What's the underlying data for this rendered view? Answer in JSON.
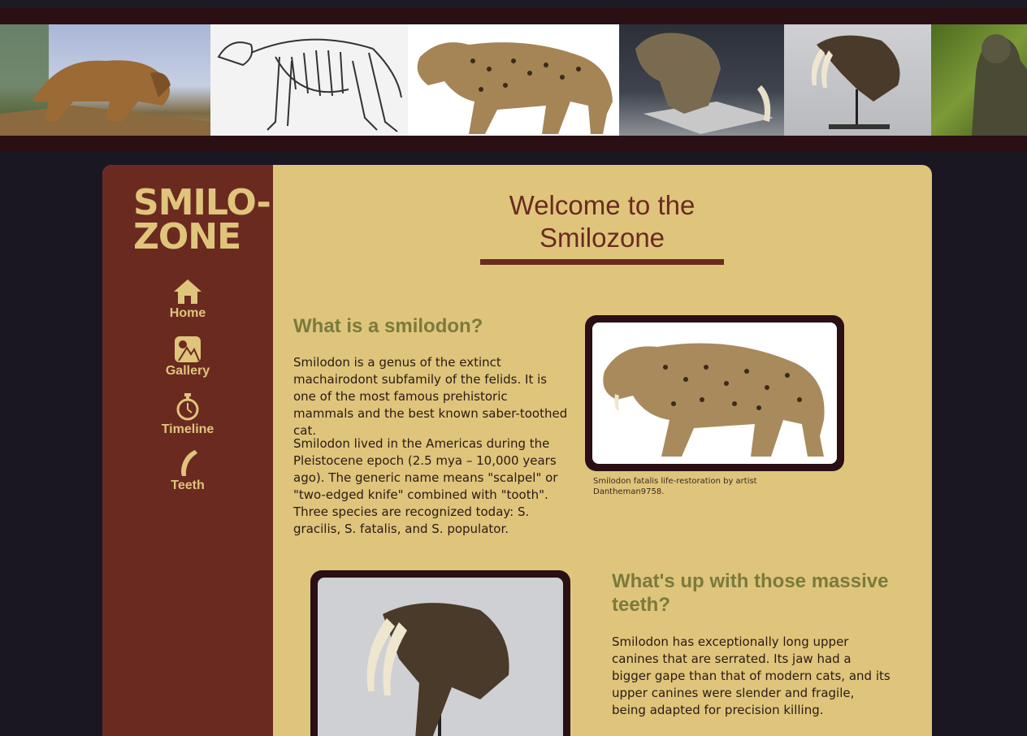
{
  "banner": {
    "images": [
      "saber-tooth-painting",
      "smilodon-skeleton",
      "smilodon-walking",
      "smilodon-skull-museum",
      "smilodon-skull-mounted",
      "smilodon-statue"
    ]
  },
  "sidebar": {
    "logo_line1": "SMILO-",
    "logo_line2": "ZONE",
    "items": [
      {
        "label": "Home",
        "icon": "home-icon"
      },
      {
        "label": "Gallery",
        "icon": "gallery-icon"
      },
      {
        "label": "Timeline",
        "icon": "stopwatch-icon"
      },
      {
        "label": "Teeth",
        "icon": "tooth-icon"
      }
    ]
  },
  "main": {
    "title": "Welcome to the Smilozone",
    "section1": {
      "heading": "What is a smilodon?",
      "p1": "Smilodon is a genus of the extinct machairodont subfamily of the felids. It is one of the most famous prehistoric mammals and the best known saber-toothed cat.",
      "p2": "Smilodon lived in the Americas during the Pleistocene epoch (2.5 mya – 10,000 years ago). The generic name means \"scalpel\" or \"two-edged knife\" combined with \"tooth\". Three species are recognized today: S. gracilis, S. fatalis, and S. populator.",
      "caption": "Smilodon fatalis life-restoration by artist Dantheman9758."
    },
    "section2": {
      "heading": "What's up with those massive teeth?",
      "p1": "Smilodon has exceptionally long upper canines that are serrated. Its jaw had a bigger gape than that of modern cats, and its upper canines were slender and fragile, being adapted for precision killing."
    }
  },
  "colors": {
    "page_bg": "#1b1722",
    "banner_bg": "#2a0f14",
    "sidebar": "#6b2a20",
    "content_bg": "#dfc57c",
    "heading_green": "#7b7a3c",
    "frame": "#2a0f14"
  }
}
